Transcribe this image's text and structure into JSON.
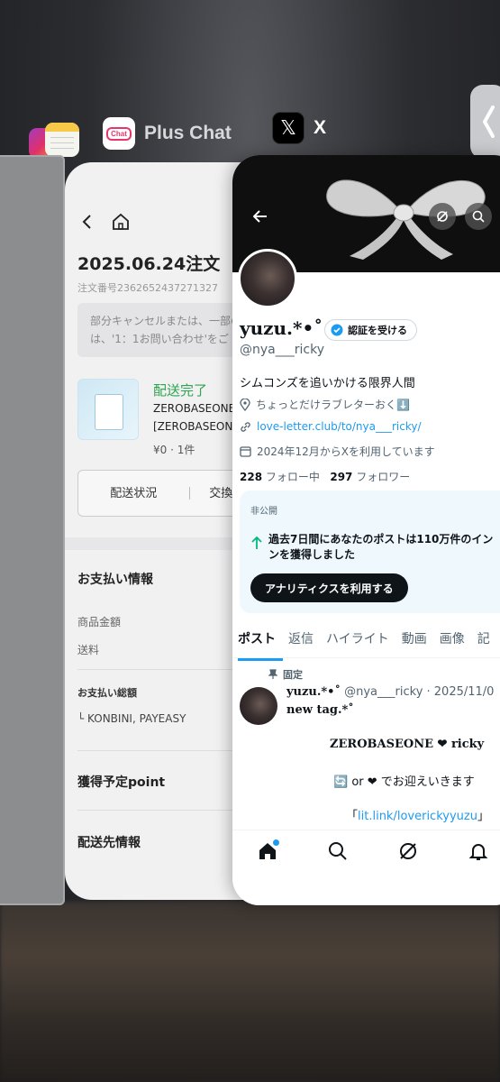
{
  "switcher": {
    "apps": [
      {
        "name": "Plus Chat",
        "icon": "plus-chat-icon",
        "icon_text": "Chat"
      },
      {
        "name": "X",
        "icon": "x-logo-icon"
      }
    ]
  },
  "shop": {
    "order_title": "2025.06.24注文",
    "order_number": "注文番号2362652437271327",
    "notice_line1": "部分キャンセルまたは、一部の",
    "notice_line2": "は、'1：1お問い合わせ'をご",
    "status": "配送完了",
    "product_line1": "ZEROBASEONE",
    "product_line2": "[ZEROBASEONE",
    "price": "¥0 · 1件",
    "btn_delivery": "配送状況",
    "btn_exchange": "交換リクエスト",
    "payment_title": "お支払い情報",
    "item_amount": "商品金額",
    "shipping": "送料",
    "total_label": "お支払い総額",
    "payment_method": "└ KONBINI, PAYEASY",
    "points": "獲得予定point",
    "shipping_info": "配送先情報"
  },
  "x": {
    "name": "yuzu.*•˚",
    "verify_label": "認証を受ける",
    "handle": "@nya___ricky",
    "bio": "シムコンズを追いかける限界人間",
    "location": "ちょっとだけラブレターおく⬇️",
    "link": "love-letter.club/to/nya___ricky/",
    "joined": "2024年12月からXを利用しています",
    "following_count": "228",
    "following_label": "フォロー中",
    "followers_count": "297",
    "followers_label": "フォロワー",
    "analytics": {
      "private_label": "非公開",
      "stat_line1": "過去7日間にあなたのポストは110万件のイン",
      "stat_line2": "ンを獲得しました",
      "button": "アナリティクスを利用する"
    },
    "tabs": [
      "ポスト",
      "返信",
      "ハイライト",
      "動画",
      "画像",
      "記"
    ],
    "pinned_label": "固定",
    "post": {
      "author": "yuzu.*•˚",
      "meta": "@nya___ricky · 2025/11/0",
      "line1": "new tag.*˚",
      "line2": "ZEROBASEONE ❤ ricky",
      "line3": "🔄 or ❤ でお迎えいきます",
      "link": "lit.link/loverickyyuzu",
      "link_open": "「",
      "link_close": "」"
    }
  },
  "colors": {
    "x_blue": "#1d9bf0",
    "shop_green": "#2da44e"
  }
}
